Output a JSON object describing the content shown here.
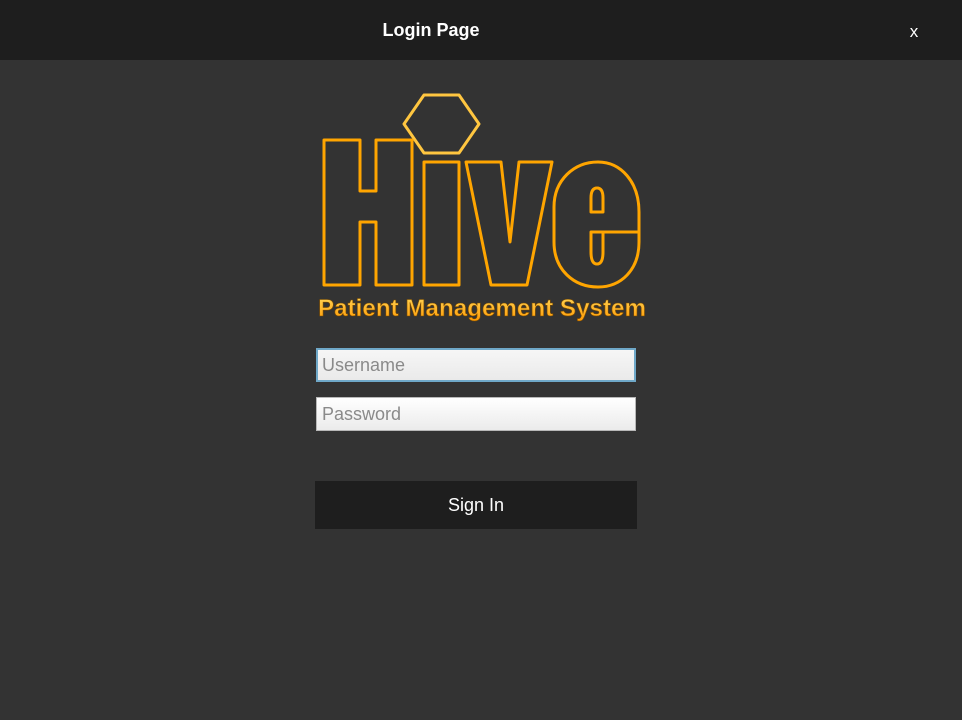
{
  "window": {
    "title": "Login Page",
    "close_label": "x"
  },
  "logo": {
    "name": "Hive",
    "subtitle": "Patient Management System",
    "accent": "#ffa500",
    "accent_light": "#ffd060"
  },
  "form": {
    "username_placeholder": "Username",
    "username_value": "",
    "password_placeholder": "Password",
    "password_value": "",
    "signin_label": "Sign In"
  }
}
